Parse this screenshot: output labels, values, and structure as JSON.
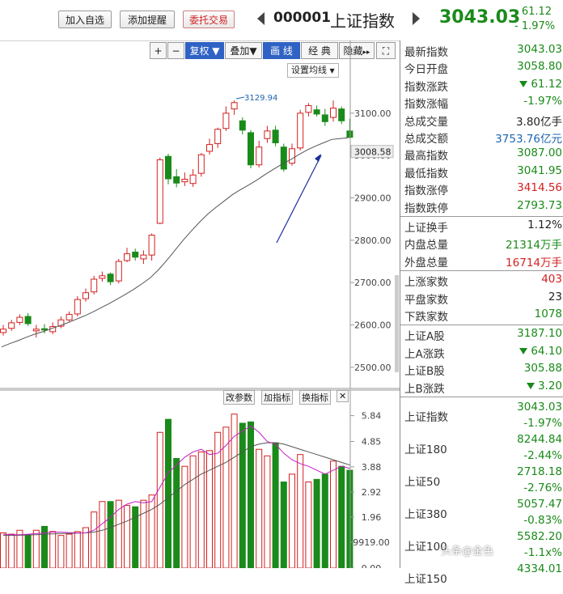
{
  "header": {
    "add_favorite": "加入自选",
    "add_alert": "添加提醒",
    "trade": "委托交易",
    "code": "000001",
    "name": "上证指数",
    "price": "3043.03",
    "change": "- 61.12",
    "change_pct": "- 1.97%"
  },
  "toolbar": {
    "plus": "+",
    "minus": "−",
    "rights": "复权",
    "overlay": "叠加",
    "draw_line": "画 线",
    "classic": "经 典",
    "hide": "隐藏",
    "set_ma": "设置均线"
  },
  "kline": {
    "price_labels": [
      "3100.00",
      "3000.00",
      "2900.00",
      "2800.00",
      "2700.00",
      "2600.00",
      "2500.00"
    ],
    "current_tag": "3008.58",
    "high_marker": "3129.94"
  },
  "volume": {
    "buttons": [
      "改参数",
      "加指标",
      "换指标"
    ],
    "close_button": "✕",
    "axis_labels": [
      "5.84",
      "4.85",
      "3.88",
      "2.92",
      "1.96",
      "9919.00",
      "0.00"
    ]
  },
  "panel": {
    "quote": [
      {
        "label": "最新指数",
        "value": "3043.03",
        "cls": "g"
      },
      {
        "label": "今日开盘",
        "value": "3058.80",
        "cls": "g"
      },
      {
        "label": "指数涨跌",
        "value": "61.12",
        "cls": "g",
        "arrow": true
      },
      {
        "label": "指数涨幅",
        "value": "-1.97%",
        "cls": "g"
      },
      {
        "label": "总成交量",
        "value": "3.80亿手",
        "cls": "k"
      },
      {
        "label": "总成交额",
        "value": "3753.76亿元",
        "cls": "b"
      },
      {
        "label": "最高指数",
        "value": "3087.00",
        "cls": "g"
      },
      {
        "label": "最低指数",
        "value": "3041.95",
        "cls": "g"
      },
      {
        "label": "指数涨停",
        "value": "3414.56",
        "cls": "r"
      },
      {
        "label": "指数跌停",
        "value": "2793.73",
        "cls": "g"
      }
    ],
    "turnover": [
      {
        "label": "上证换手",
        "value": "1.12%",
        "cls": "k"
      },
      {
        "label": "内盘总量",
        "value": "21314万手",
        "cls": "g"
      },
      {
        "label": "外盘总量",
        "value": "16714万手",
        "cls": "r"
      }
    ],
    "breadth": [
      {
        "label": "上涨家数",
        "value": "403",
        "cls": "r"
      },
      {
        "label": "平盘家数",
        "value": "23",
        "cls": "k"
      },
      {
        "label": "下跌家数",
        "value": "1078",
        "cls": "g"
      }
    ],
    "shares": [
      {
        "label": "上证A股",
        "value": "3187.10",
        "cls": "g"
      },
      {
        "label": "上A涨跌",
        "value": "64.10",
        "cls": "g",
        "arrow": true
      },
      {
        "label": "上证B股",
        "value": "305.88",
        "cls": "g"
      },
      {
        "label": "上B涨跌",
        "value": "3.20",
        "cls": "g",
        "arrow": true
      }
    ],
    "indices": [
      {
        "label": "上证指数",
        "value": "3043.03",
        "pct": "-1.97%"
      },
      {
        "label": "上证180",
        "value": "8244.84",
        "pct": "-2.44%"
      },
      {
        "label": "上证50",
        "value": "2718.18",
        "pct": "-2.76%"
      },
      {
        "label": "上证380",
        "value": "5057.47",
        "pct": "-0.83%"
      },
      {
        "label": "上证100",
        "value": "5582.20",
        "pct": "-1.1x%"
      },
      {
        "label": "上证150",
        "value": "4334.01",
        "pct": ""
      }
    ]
  },
  "watermark": "头条@金色",
  "colors": {
    "up": "#d32020",
    "down": "#1a8a1a",
    "accent": "#2f62c4"
  },
  "chart_data": {
    "type": "candlestick",
    "ylim": [
      2450,
      3180
    ],
    "candles": [
      {
        "o": 2582,
        "c": 2590,
        "h": 2600,
        "l": 2575
      },
      {
        "o": 2592,
        "c": 2605,
        "h": 2612,
        "l": 2586
      },
      {
        "o": 2606,
        "c": 2618,
        "h": 2625,
        "l": 2600
      },
      {
        "o": 2620,
        "c": 2603,
        "h": 2628,
        "l": 2598
      },
      {
        "o": 2586,
        "c": 2590,
        "h": 2600,
        "l": 2570
      },
      {
        "o": 2591,
        "c": 2588,
        "h": 2602,
        "l": 2580
      },
      {
        "o": 2584,
        "c": 2596,
        "h": 2606,
        "l": 2578
      },
      {
        "o": 2597,
        "c": 2612,
        "h": 2620,
        "l": 2592
      },
      {
        "o": 2612,
        "c": 2625,
        "h": 2632,
        "l": 2608
      },
      {
        "o": 2626,
        "c": 2660,
        "h": 2668,
        "l": 2620
      },
      {
        "o": 2662,
        "c": 2676,
        "h": 2686,
        "l": 2655
      },
      {
        "o": 2678,
        "c": 2708,
        "h": 2716,
        "l": 2672
      },
      {
        "o": 2710,
        "c": 2716,
        "h": 2726,
        "l": 2702
      },
      {
        "o": 2720,
        "c": 2702,
        "h": 2724,
        "l": 2694
      },
      {
        "o": 2704,
        "c": 2750,
        "h": 2756,
        "l": 2698
      },
      {
        "o": 2752,
        "c": 2768,
        "h": 2782,
        "l": 2748
      },
      {
        "o": 2772,
        "c": 2760,
        "h": 2780,
        "l": 2752
      },
      {
        "o": 2756,
        "c": 2765,
        "h": 2776,
        "l": 2744
      },
      {
        "o": 2765,
        "c": 2812,
        "h": 2816,
        "l": 2752
      },
      {
        "o": 2840,
        "c": 2990,
        "h": 2995,
        "l": 2838
      },
      {
        "o": 2998,
        "c": 2945,
        "h": 3004,
        "l": 2932
      },
      {
        "o": 2950,
        "c": 2935,
        "h": 2968,
        "l": 2925
      },
      {
        "o": 2938,
        "c": 2944,
        "h": 2960,
        "l": 2928
      },
      {
        "o": 2934,
        "c": 2954,
        "h": 2968,
        "l": 2926
      },
      {
        "o": 2958,
        "c": 3002,
        "h": 3006,
        "l": 2950
      },
      {
        "o": 3010,
        "c": 3026,
        "h": 3040,
        "l": 3002
      },
      {
        "o": 3028,
        "c": 3062,
        "h": 3066,
        "l": 3018
      },
      {
        "o": 3064,
        "c": 3100,
        "h": 3116,
        "l": 3058
      },
      {
        "o": 3110,
        "c": 3125,
        "h": 3130,
        "l": 3096
      },
      {
        "o": 3082,
        "c": 3060,
        "h": 3090,
        "l": 3050
      },
      {
        "o": 3054,
        "c": 2978,
        "h": 3060,
        "l": 2970
      },
      {
        "o": 2978,
        "c": 3020,
        "h": 3035,
        "l": 2972
      },
      {
        "o": 3040,
        "c": 3058,
        "h": 3070,
        "l": 3030
      },
      {
        "o": 3060,
        "c": 3030,
        "h": 3070,
        "l": 3022
      },
      {
        "o": 3020,
        "c": 2968,
        "h": 3028,
        "l": 2962
      },
      {
        "o": 2982,
        "c": 3016,
        "h": 3028,
        "l": 2976
      },
      {
        "o": 3018,
        "c": 3100,
        "h": 3108,
        "l": 3012
      },
      {
        "o": 3102,
        "c": 3118,
        "h": 3124,
        "l": 3092
      },
      {
        "o": 3108,
        "c": 3098,
        "h": 3118,
        "l": 3092
      },
      {
        "o": 3096,
        "c": 3080,
        "h": 3110,
        "l": 3070
      },
      {
        "o": 3090,
        "c": 3112,
        "h": 3130,
        "l": 3080
      },
      {
        "o": 3110,
        "c": 3082,
        "h": 3116,
        "l": 3074
      },
      {
        "o": 3058,
        "c": 3043,
        "h": 3087,
        "l": 3041
      }
    ],
    "ma": [
      2548,
      2556,
      2563,
      2571,
      2578,
      2584,
      2591,
      2598,
      2605,
      2613,
      2621,
      2630,
      2640,
      2650,
      2661,
      2672,
      2684,
      2697,
      2711,
      2730,
      2752,
      2776,
      2800,
      2822,
      2843,
      2862,
      2878,
      2893,
      2908,
      2920,
      2931,
      2943,
      2956,
      2968,
      2980,
      2990,
      3002,
      3013,
      3022,
      3030,
      3038,
      3040,
      3042
    ],
    "volume": {
      "values": [
        1.35,
        1.3,
        1.45,
        1.25,
        1.45,
        1.6,
        1.4,
        1.25,
        1.3,
        1.4,
        1.55,
        2.15,
        2.55,
        2.55,
        2.6,
        2.4,
        2.35,
        2.6,
        2.8,
        5.2,
        5.7,
        4.2,
        3.9,
        4.3,
        4.45,
        4.5,
        5.2,
        5.4,
        5.9,
        5.55,
        5.6,
        4.55,
        4.3,
        4.8,
        3.3,
        3.6,
        4.35,
        3.3,
        3.4,
        3.6,
        4.1,
        3.9,
        3.75
      ],
      "ma_purple": [
        1.3,
        1.28,
        1.28,
        1.3,
        1.32,
        1.35,
        1.38,
        1.38,
        1.36,
        1.35,
        1.35,
        1.45,
        1.7,
        1.95,
        2.25,
        2.45,
        2.55,
        2.5,
        2.55,
        3.1,
        3.65,
        3.95,
        4.25,
        4.45,
        4.55,
        4.35,
        4.4,
        4.7,
        5.05,
        5.25,
        5.45,
        5.2,
        4.85,
        4.75,
        4.4,
        4.15,
        4.0,
        3.9,
        3.75,
        3.6,
        3.75,
        3.9,
        3.82
      ],
      "ma_gray": [
        1.25,
        1.25,
        1.26,
        1.27,
        1.28,
        1.3,
        1.31,
        1.32,
        1.33,
        1.34,
        1.35,
        1.38,
        1.45,
        1.55,
        1.68,
        1.8,
        1.95,
        2.1,
        2.25,
        2.45,
        2.7,
        2.95,
        3.2,
        3.4,
        3.6,
        3.75,
        3.9,
        4.05,
        4.25,
        4.45,
        4.65,
        4.75,
        4.8,
        4.8,
        4.75,
        4.65,
        4.55,
        4.45,
        4.35,
        4.25,
        4.15,
        4.05,
        3.95
      ],
      "ylim": [
        0,
        6.2
      ]
    }
  }
}
